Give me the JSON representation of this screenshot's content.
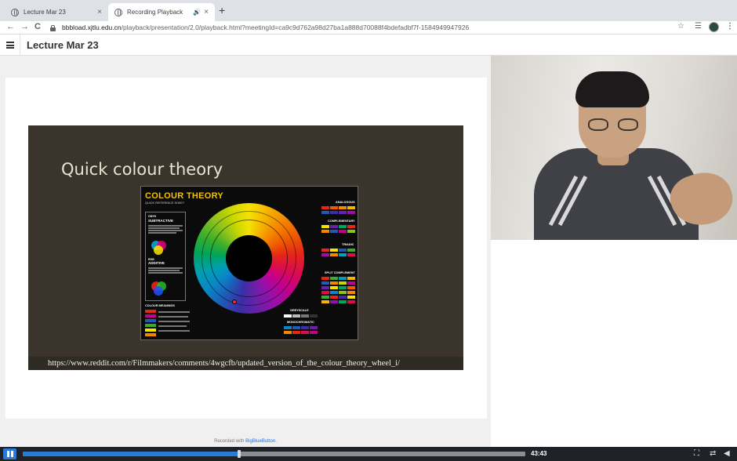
{
  "browser": {
    "tabs": [
      {
        "label": "Lecture Mar 23",
        "active": false
      },
      {
        "label": "Recording Playback",
        "active": true
      }
    ],
    "url": {
      "host": "bbbload.xjtlu.edu.cn",
      "path": "/playback/presentation/2.0/playback.html?meetingId=ca9c9d762a98d27ba1a888d70088f4bdefadbf7f-1584949947926"
    }
  },
  "header": {
    "title": "Lecture Mar 23"
  },
  "slide": {
    "title": "Quick colour theory",
    "source_url": "https://www.reddit.com/r/Filmmakers/comments/4wgcfb/updated_version_of_the_colour_theory_wheel_i/",
    "sheet": {
      "title": "COLOUR THEORY",
      "subtitle": "QUICK REFERENCE SHEET",
      "subtractive_label": "SUBTRACTIVE",
      "cmyk_label": "CMYK",
      "rgb_label": "RGB",
      "additive_label": "ADDITIVE",
      "meanings_label": "COLOUR MEANINGS",
      "analogous_label": "ANALOGOUS",
      "complementary_label": "COMPLEMENTARY",
      "triadic_label": "TRIADIC",
      "split_label": "SPLIT COMPLEMENT",
      "greyscale_label": "GREYSCALE",
      "mono_label": "MONOCHROMATIC"
    }
  },
  "footer": {
    "credit_prefix": "Recorded with ",
    "credit_link": "BigBlueButton",
    "credit_suffix": "."
  },
  "player": {
    "duration": "43:43",
    "progress": 0.43,
    "accent": "#2a7ad6"
  },
  "icons": {
    "close_icon": "×",
    "speaker_icon": "🔊",
    "new_tab_icon": "+",
    "back_icon": "←",
    "forward_icon": "→",
    "reload_icon": "C",
    "star_icon": "☆",
    "playlist_icon": "☰",
    "menu_icon": "⋮",
    "fullscreen_icon": "⛶",
    "swap_icon": "⇄",
    "volume_icon": "◀"
  }
}
